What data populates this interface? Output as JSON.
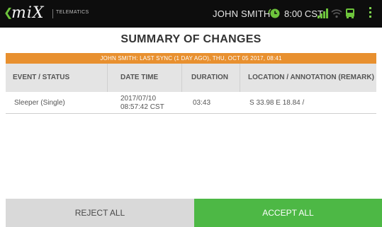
{
  "header": {
    "logo_text": "miX",
    "logo_subtitle": "TELEMATICS",
    "user_name": "JOHN SMITH",
    "time": "8:00 CST",
    "accent_color": "#6ec43c"
  },
  "page": {
    "title": "SUMMARY OF CHANGES",
    "sync_banner": "JOHN SMITH: LAST SYNC (1 DAY AGO), THU, OCT 05 2017, 08:41"
  },
  "table": {
    "columns": [
      "EVENT / STATUS",
      "DATE TIME",
      "DURATION",
      "LOCATION / ANNOTATION (REMARK)"
    ],
    "rows": [
      {
        "event": "Sleeper (Single)",
        "date": "2017/07/10",
        "time": "08:57:42 CST",
        "duration": "03:43",
        "location": "S 33.98 E 18.84 /"
      }
    ]
  },
  "actions": {
    "reject_label": "REJECT ALL",
    "accept_label": "ACCEPT ALL",
    "accept_color": "#4db845"
  },
  "icons": [
    "back-arrow-icon",
    "clock-icon",
    "signal-icon",
    "wifi-icon",
    "bus-icon",
    "menu-icon"
  ]
}
